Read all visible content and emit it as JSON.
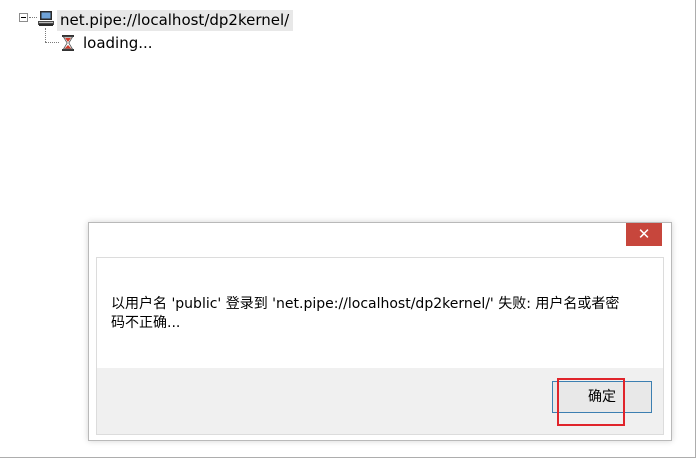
{
  "tree": {
    "root": {
      "label": "net.pipe://localhost/dp2kernel/",
      "icon": "computer-icon",
      "expanded": true
    },
    "children": [
      {
        "label": "loading...",
        "icon": "hourglass-icon"
      }
    ]
  },
  "dialog": {
    "close_label": "✕",
    "message": "以用户名 'public' 登录到 'net.pipe://localhost/dp2kernel/' 失败: 用户名或者密码不正确...",
    "ok_label": "确定"
  },
  "colors": {
    "close_button": "#c7463c",
    "highlight": "#e0242b",
    "button_border": "#3c7fb1",
    "selection_bg": "#e8e8e8"
  }
}
